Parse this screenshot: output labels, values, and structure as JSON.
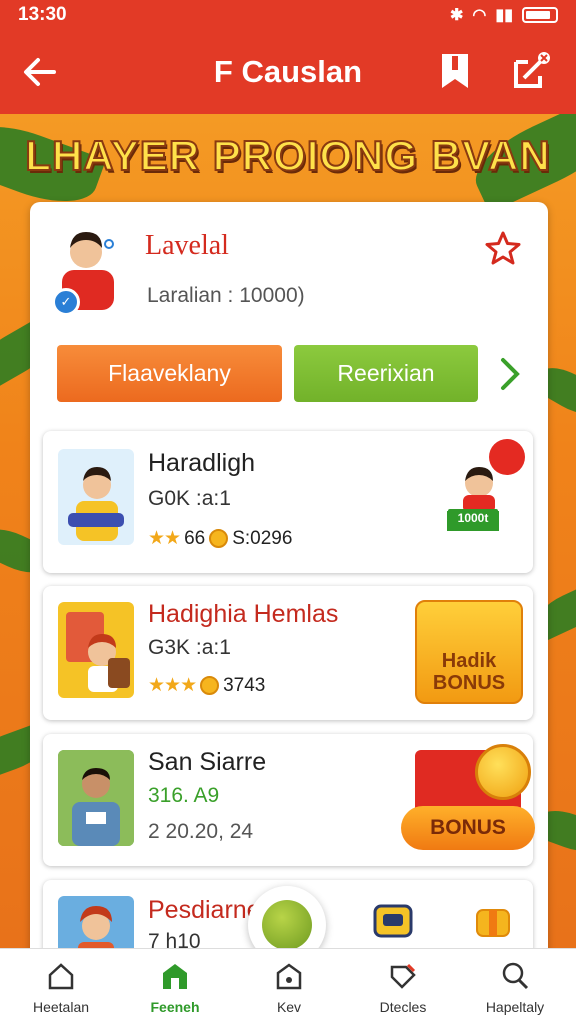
{
  "status_bar": {
    "time": "13:30"
  },
  "app_bar": {
    "title": "F Causlan"
  },
  "banner": {
    "title": "LHAYER PROIONG BVAN"
  },
  "profile": {
    "name": "Lavelal",
    "subtitle": "Laralian : 10000)"
  },
  "actions": {
    "primary_label": "Flaaveklany",
    "secondary_label": "Reerixian"
  },
  "items": [
    {
      "title": "Haradligh",
      "meta": "G0K :a:1",
      "stars": "★★",
      "rating": "66",
      "extra": "S:0296",
      "badge_label": "1000t"
    },
    {
      "title": "Hadighia Hemlas",
      "meta": "G3K :a:1",
      "stars": "★★★",
      "rating": "",
      "extra": "3743",
      "badge_label": "Hadik BONUS"
    },
    {
      "title": "San Siarre",
      "meta": "316. A9",
      "stars": "",
      "rating": "",
      "extra": "2 20.20, 24",
      "badge_label": "BONUS"
    },
    {
      "title": "Pesdiarne",
      "meta": "7 h10",
      "stars": "",
      "rating": "",
      "extra": "",
      "badge_label": ""
    }
  ],
  "bottom_nav": [
    {
      "label": "Heetalan",
      "icon": "home-icon"
    },
    {
      "label": "Feeneh",
      "icon": "store-icon"
    },
    {
      "label": "Kev",
      "icon": "wallet-icon"
    },
    {
      "label": "Dtecles",
      "icon": "tag-icon"
    },
    {
      "label": "Hapeltaly",
      "icon": "profile-icon"
    }
  ],
  "colors": {
    "brand_red": "#e23a26",
    "accent_orange": "#ec6a1f",
    "accent_green": "#72b22a",
    "active_nav": "#2f9a2a"
  }
}
